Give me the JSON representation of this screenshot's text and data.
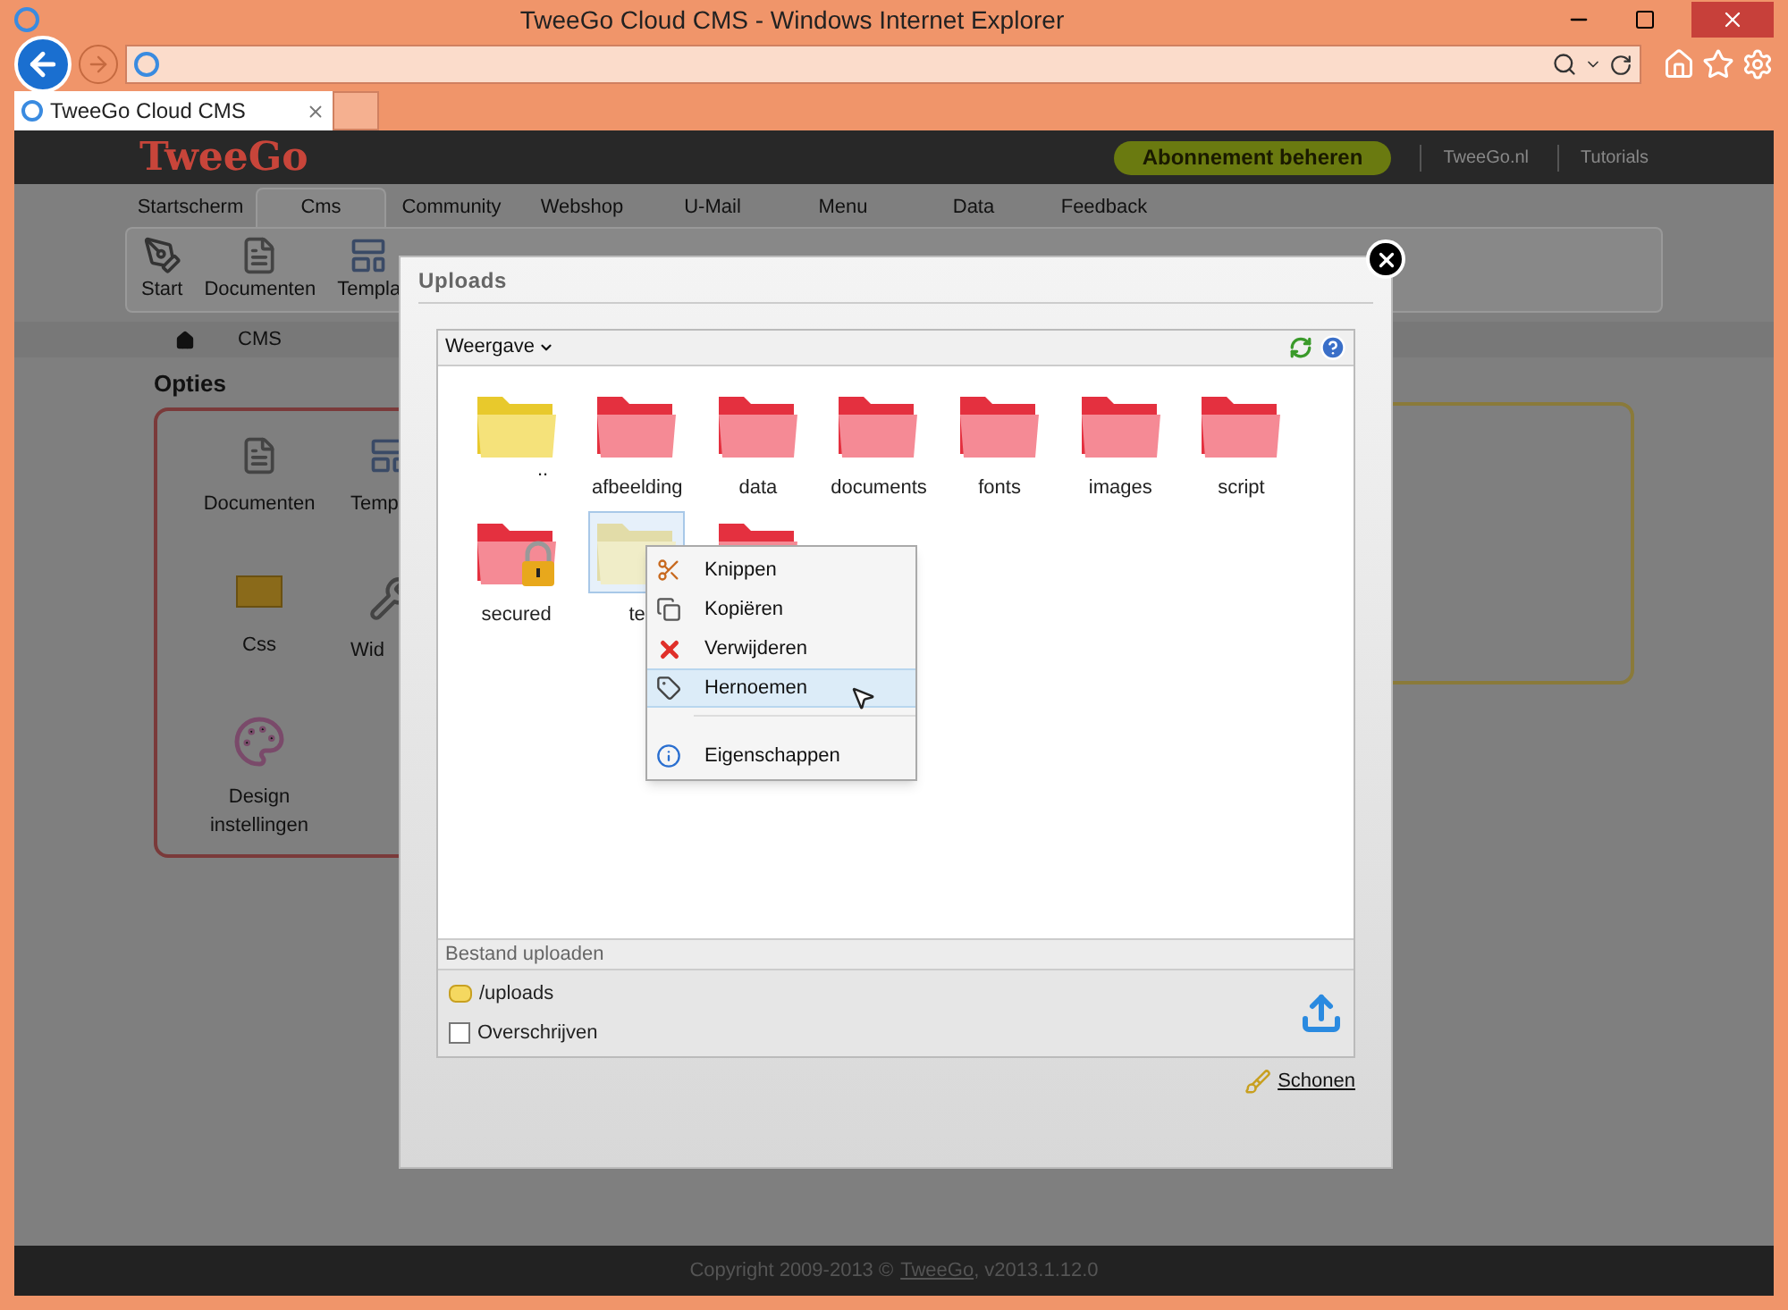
{
  "window": {
    "title": "TweeGo Cloud CMS - Windows Internet Explorer"
  },
  "browser_tabs": [
    {
      "label": "TweeGo Cloud CMS",
      "selected": true
    }
  ],
  "header": {
    "logo": "TweeGo",
    "subscription_button": "Abonnement beheren",
    "links": [
      "TweeGo.nl",
      "Tutorials"
    ]
  },
  "nav_tabs": [
    {
      "label": "Startscherm",
      "selected": false
    },
    {
      "label": "Cms",
      "selected": true
    },
    {
      "label": "Community",
      "selected": false
    },
    {
      "label": "Webshop",
      "selected": false
    },
    {
      "label": "U-Mail",
      "selected": false
    },
    {
      "label": "Menu",
      "selected": false
    },
    {
      "label": "Data",
      "selected": false
    },
    {
      "label": "Feedback",
      "selected": false
    }
  ],
  "toolbar": [
    {
      "label": "Start",
      "kind": "start"
    },
    {
      "label": "Documenten",
      "kind": "documents"
    },
    {
      "label": "Templa",
      "kind": "template"
    }
  ],
  "breadcrumb": [
    "CMS"
  ],
  "options": {
    "title": "Opties",
    "items": [
      {
        "label": "Documenten",
        "kind": "documents"
      },
      {
        "label": "Temp",
        "kind": "template"
      },
      {
        "label": "Css",
        "kind": "css"
      },
      {
        "label": "Wid",
        "kind": "widget"
      },
      {
        "label": "Design instellingen",
        "kind": "design"
      }
    ]
  },
  "dialog": {
    "title": "Uploads",
    "view_menu": "Weergave",
    "folders": [
      {
        "name": "..",
        "kind": "parent",
        "selected": false
      },
      {
        "name": "afbeelding",
        "kind": "folder",
        "selected": false
      },
      {
        "name": "data",
        "kind": "folder",
        "selected": false
      },
      {
        "name": "documents",
        "kind": "folder",
        "selected": false
      },
      {
        "name": "fonts",
        "kind": "folder",
        "selected": false
      },
      {
        "name": "images",
        "kind": "folder",
        "selected": false
      },
      {
        "name": "script",
        "kind": "folder",
        "selected": false
      },
      {
        "name": "secured",
        "kind": "locked",
        "selected": false
      },
      {
        "name": "te",
        "kind": "folder",
        "selected": true
      },
      {
        "kind": "folder",
        "selected": false
      }
    ],
    "context_menu": [
      {
        "label": "Knippen",
        "kind": "cut",
        "selected": false
      },
      {
        "label": "Kopiëren",
        "kind": "copy",
        "selected": false
      },
      {
        "label": "Verwijderen",
        "kind": "delete",
        "selected": false
      },
      {
        "label": "Hernoemen",
        "kind": "rename",
        "selected": true
      },
      {
        "label": "Eigenschappen",
        "kind": "info",
        "selected": false
      }
    ],
    "upload": {
      "title": "Bestand uploaden",
      "path": "/uploads",
      "overwrite": {
        "label": "Overschrijven",
        "checked": false
      }
    },
    "clean_link": "Schonen"
  },
  "footer": {
    "copyright": "Copyright 2009-2013 ©",
    "link": "TweeGo",
    "version": ", v2013.1.12.0"
  }
}
